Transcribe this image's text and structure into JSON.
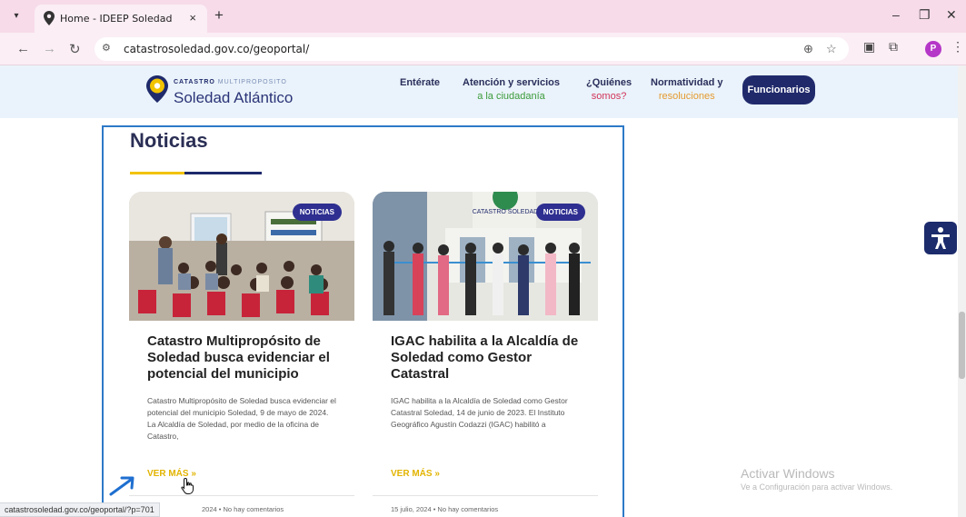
{
  "browser": {
    "tab_title": "Home - IDEEP Soledad",
    "tab_close": "×",
    "new_tab": "+",
    "url": "catastrosoledad.gov.co/geoportal/",
    "profile_initial": "P",
    "window_controls": [
      "–",
      "❐",
      "✕"
    ]
  },
  "site": {
    "logo_small_bold": "CATASTRO",
    "logo_small_rest": " MULTIPROPOSITO",
    "logo_main": "Soledad Atlántico",
    "nav": [
      {
        "line1": "Entérate",
        "line2": ""
      },
      {
        "line1": "Atención y servicios",
        "line2": "a la ciudadanía"
      },
      {
        "line1": "¿Quiénes",
        "line2": "somos?"
      },
      {
        "line1": "Normatividad y",
        "line2": "resoluciones"
      }
    ],
    "cta_label": "Funcionarios",
    "colors": {
      "navy": "#1f2a6b",
      "yellow": "#f2c300",
      "green": "#3b9b3a",
      "red": "#d2335a",
      "orange": "#e59a2f"
    }
  },
  "news": {
    "section_title": "Noticias",
    "cards": [
      {
        "badge": "NOTICIAS",
        "title": "Catastro Multipropósito de Soledad busca evidenciar el potencial del municipio",
        "excerpt": "Catastro Multipropósito de Soledad busca evidenciar el potencial del municipio Soledad, 9  de mayo de 2024.  La Alcaldía de Soledad, por medio de la oficina de Catastro,",
        "cta": "VER MÁS »",
        "meta": "2024  •  No hay comentarios"
      },
      {
        "badge": "NOTICIAS",
        "title": "IGAC habilita a la Alcaldía de Soledad como Gestor Catastral",
        "excerpt": "IGAC habilita a la Alcaldía de Soledad como Gestor Catastral   Soledad, 14 de junio de 2023. El Instituto Geográfico Agustín Codazzi (IGAC) habilitó a",
        "cta": "VER MÁS »",
        "meta": "15 julio, 2024  •  No hay comentarios",
        "building_sign": "CATASTRO SOLEDAD"
      }
    ]
  },
  "status_bar": {
    "url": "catastrosoledad.gov.co/geoportal/?p=701"
  },
  "windows_watermark": {
    "line1": "Activar Windows",
    "line2": "Ve a Configuración para activar Windows."
  },
  "icons": [
    "tab-menu-icon",
    "location-pin-icon",
    "back-icon",
    "forward-icon",
    "reload-icon",
    "site-settings-icon",
    "zoom-icon",
    "bookmark-star-icon",
    "cast-icon",
    "extensions-icon",
    "more-icon",
    "accessibility-icon",
    "cursor-hand-icon"
  ]
}
